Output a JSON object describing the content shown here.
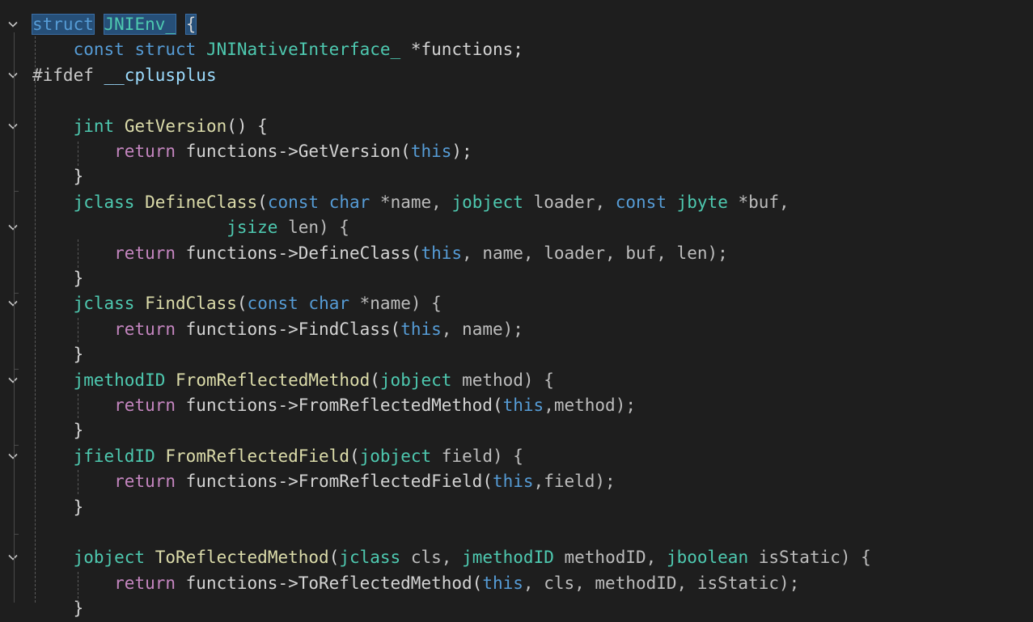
{
  "theme": {
    "bg": "#1e1e1e",
    "text": "#d4d4d4",
    "keyword_blue": "#569cd6",
    "type_teal": "#4ec9b0",
    "func_yellow": "#dcdcaa",
    "control_purple": "#c586c0",
    "param_gray": "#9cdcfe",
    "macro_blue": "#9cdcfe",
    "selection": "#264f78"
  },
  "icons": {
    "fold": "chevron-down-icon"
  },
  "lines": [
    {
      "fold": true,
      "tokens": [
        [
          "struct",
          "kw",
          "sel"
        ],
        [
          " ",
          "",
          ""
        ],
        [
          "JNIEnv_",
          "ty",
          "sel"
        ],
        [
          " ",
          "",
          ""
        ],
        [
          "{",
          "pn",
          "sel"
        ]
      ]
    },
    {
      "fold": false,
      "tokens": [
        [
          "    ",
          "",
          ""
        ],
        [
          "const",
          "kw",
          ""
        ],
        [
          " ",
          "",
          ""
        ],
        [
          "struct",
          "kw",
          ""
        ],
        [
          " ",
          "",
          ""
        ],
        [
          "JNINativeInterface_",
          "ty",
          ""
        ],
        [
          " *",
          "pn",
          ""
        ],
        [
          "functions",
          "tx",
          ""
        ],
        [
          ";",
          "pn",
          ""
        ]
      ]
    },
    {
      "fold": true,
      "tokens": [
        [
          "#ifdef",
          "pp",
          ""
        ],
        [
          " ",
          "",
          ""
        ],
        [
          "__cplusplus",
          "mc",
          ""
        ]
      ]
    },
    {
      "fold": false,
      "tokens": []
    },
    {
      "fold": true,
      "tokens": [
        [
          "    ",
          "",
          ""
        ],
        [
          "jint",
          "ty",
          ""
        ],
        [
          " ",
          "",
          ""
        ],
        [
          "GetVersion",
          "fn",
          ""
        ],
        [
          "() {",
          "pn",
          ""
        ]
      ]
    },
    {
      "fold": false,
      "tokens": [
        [
          "        ",
          "",
          ""
        ],
        [
          "return",
          "ctl",
          ""
        ],
        [
          " functions->",
          "tx",
          ""
        ],
        [
          "GetVersion",
          "tx",
          ""
        ],
        [
          "(",
          "pn",
          ""
        ],
        [
          "this",
          "kw",
          ""
        ],
        [
          ");",
          "pn",
          ""
        ]
      ]
    },
    {
      "fold": false,
      "tokens": [
        [
          "    ",
          "",
          ""
        ],
        [
          "}",
          "pn",
          ""
        ]
      ]
    },
    {
      "fold": false,
      "tokens": [
        [
          "    ",
          "",
          ""
        ],
        [
          "jclass",
          "ty",
          ""
        ],
        [
          " ",
          "",
          ""
        ],
        [
          "DefineClass",
          "fn",
          ""
        ],
        [
          "(",
          "pn",
          ""
        ],
        [
          "const",
          "kw",
          ""
        ],
        [
          " ",
          "",
          ""
        ],
        [
          "char",
          "kw",
          ""
        ],
        [
          " *name, ",
          "pm",
          ""
        ],
        [
          "jobject",
          "ty",
          ""
        ],
        [
          " loader, ",
          "pm",
          ""
        ],
        [
          "const",
          "kw",
          ""
        ],
        [
          " ",
          "",
          ""
        ],
        [
          "jbyte",
          "ty",
          ""
        ],
        [
          " *buf,",
          "pm",
          ""
        ]
      ]
    },
    {
      "fold": true,
      "tokens": [
        [
          "                   ",
          "",
          ""
        ],
        [
          "jsize",
          "ty",
          ""
        ],
        [
          " len) {",
          "pm",
          ""
        ]
      ]
    },
    {
      "fold": false,
      "tokens": [
        [
          "        ",
          "",
          ""
        ],
        [
          "return",
          "ctl",
          ""
        ],
        [
          " functions->",
          "tx",
          ""
        ],
        [
          "DefineClass",
          "tx",
          ""
        ],
        [
          "(",
          "pn",
          ""
        ],
        [
          "this",
          "kw",
          ""
        ],
        [
          ", name, loader, buf, len);",
          "pm",
          ""
        ]
      ]
    },
    {
      "fold": false,
      "tokens": [
        [
          "    ",
          "",
          ""
        ],
        [
          "}",
          "pn",
          ""
        ]
      ]
    },
    {
      "fold": true,
      "tokens": [
        [
          "    ",
          "",
          ""
        ],
        [
          "jclass",
          "ty",
          ""
        ],
        [
          " ",
          "",
          ""
        ],
        [
          "FindClass",
          "fn",
          ""
        ],
        [
          "(",
          "pn",
          ""
        ],
        [
          "const",
          "kw",
          ""
        ],
        [
          " ",
          "",
          ""
        ],
        [
          "char",
          "kw",
          ""
        ],
        [
          " *name) {",
          "pm",
          ""
        ]
      ]
    },
    {
      "fold": false,
      "tokens": [
        [
          "        ",
          "",
          ""
        ],
        [
          "return",
          "ctl",
          ""
        ],
        [
          " functions->",
          "tx",
          ""
        ],
        [
          "FindClass",
          "tx",
          ""
        ],
        [
          "(",
          "pn",
          ""
        ],
        [
          "this",
          "kw",
          ""
        ],
        [
          ", name);",
          "pm",
          ""
        ]
      ]
    },
    {
      "fold": false,
      "tokens": [
        [
          "    ",
          "",
          ""
        ],
        [
          "}",
          "pn",
          ""
        ]
      ]
    },
    {
      "fold": true,
      "tokens": [
        [
          "    ",
          "",
          ""
        ],
        [
          "jmethodID",
          "ty",
          ""
        ],
        [
          " ",
          "",
          ""
        ],
        [
          "FromReflectedMethod",
          "fn",
          ""
        ],
        [
          "(",
          "pn",
          ""
        ],
        [
          "jobject",
          "ty",
          ""
        ],
        [
          " method) {",
          "pm",
          ""
        ]
      ]
    },
    {
      "fold": false,
      "tokens": [
        [
          "        ",
          "",
          ""
        ],
        [
          "return",
          "ctl",
          ""
        ],
        [
          " functions->",
          "tx",
          ""
        ],
        [
          "FromReflectedMethod",
          "tx",
          ""
        ],
        [
          "(",
          "pn",
          ""
        ],
        [
          "this",
          "kw",
          ""
        ],
        [
          ",method);",
          "pm",
          ""
        ]
      ]
    },
    {
      "fold": false,
      "tokens": [
        [
          "    ",
          "",
          ""
        ],
        [
          "}",
          "pn",
          ""
        ]
      ]
    },
    {
      "fold": true,
      "tokens": [
        [
          "    ",
          "",
          ""
        ],
        [
          "jfieldID",
          "ty",
          ""
        ],
        [
          " ",
          "",
          ""
        ],
        [
          "FromReflectedField",
          "fn",
          ""
        ],
        [
          "(",
          "pn",
          ""
        ],
        [
          "jobject",
          "ty",
          ""
        ],
        [
          " field) {",
          "pm",
          ""
        ]
      ]
    },
    {
      "fold": false,
      "tokens": [
        [
          "        ",
          "",
          ""
        ],
        [
          "return",
          "ctl",
          ""
        ],
        [
          " functions->",
          "tx",
          ""
        ],
        [
          "FromReflectedField",
          "tx",
          ""
        ],
        [
          "(",
          "pn",
          ""
        ],
        [
          "this",
          "kw",
          ""
        ],
        [
          ",field);",
          "pm",
          ""
        ]
      ]
    },
    {
      "fold": false,
      "tokens": [
        [
          "    ",
          "",
          ""
        ],
        [
          "}",
          "pn",
          ""
        ]
      ]
    },
    {
      "fold": false,
      "tokens": []
    },
    {
      "fold": true,
      "tokens": [
        [
          "    ",
          "",
          ""
        ],
        [
          "jobject",
          "ty",
          ""
        ],
        [
          " ",
          "",
          ""
        ],
        [
          "ToReflectedMethod",
          "fn",
          ""
        ],
        [
          "(",
          "pn",
          ""
        ],
        [
          "jclass",
          "ty",
          ""
        ],
        [
          " cls, ",
          "pm",
          ""
        ],
        [
          "jmethodID",
          "ty",
          ""
        ],
        [
          " methodID, ",
          "pm",
          ""
        ],
        [
          "jboolean",
          "ty",
          ""
        ],
        [
          " isStatic) {",
          "pm",
          ""
        ]
      ]
    },
    {
      "fold": false,
      "tokens": [
        [
          "        ",
          "",
          ""
        ],
        [
          "return",
          "ctl",
          ""
        ],
        [
          " functions->",
          "tx",
          ""
        ],
        [
          "ToReflectedMethod",
          "tx",
          ""
        ],
        [
          "(",
          "pn",
          ""
        ],
        [
          "this",
          "kw",
          ""
        ],
        [
          ", cls, methodID, isStatic);",
          "pm",
          ""
        ]
      ]
    },
    {
      "fold": false,
      "tokens": [
        [
          "    ",
          "",
          ""
        ],
        [
          "}",
          "pn",
          ""
        ]
      ]
    }
  ]
}
